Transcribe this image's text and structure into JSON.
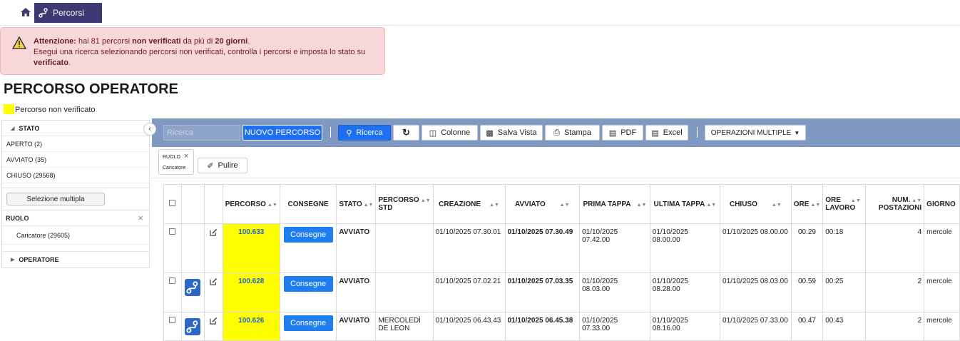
{
  "nav": {
    "tab_label": "Percorsi"
  },
  "alert": {
    "l1_prefix": "Attenzione:",
    "l1_a": " hai 81 percorsi ",
    "l1_b": "non verificati",
    "l1_c": " da più di ",
    "l1_d": "20 giorni",
    "l1_e": ".",
    "l2": "Esegui una ricerca selezionando percorsi non verificati, controlla i percorsi e imposta lo stato su",
    "l3_b": "verificato",
    "l3_e": "."
  },
  "page": {
    "title": "PERCORSO OPERATORE",
    "legend": "Percorso non verificato",
    "legend_color": "#ffff00"
  },
  "sidebar": {
    "stato_title": "STATO",
    "stato_items": [
      "APERTO (2)",
      "AVVIATO (35)",
      "CHIUSO (29568)"
    ],
    "multi_btn": "Selezione multipla",
    "ruolo_title": "RUOLO",
    "ruolo_items": [
      "Caricatore (29605)"
    ],
    "operatore_title": "OPERATORE"
  },
  "toolbar": {
    "search_placeholder": "Ricerca",
    "new_label": "NUOVO PERCORSO",
    "ricerca_label": "Ricerca",
    "colonne_label": "Colonne",
    "salva_label": "Salva Vista",
    "stampa_label": "Stampa",
    "pdf_label": "PDF",
    "excel_label": "Excel",
    "multi_label": "OPERAZIONI MULTIPLE"
  },
  "filters": {
    "chip_key": "RUOLO",
    "chip_value": "Caricatore",
    "clear_label": "Pulire"
  },
  "table": {
    "headers": {
      "percorso": "PERCORSO",
      "consegne": "CONSEGNE",
      "stato": "STATO",
      "percorso_std_1": "PERCORSO",
      "percorso_std_2": "STD",
      "creazione": "CREAZIONE",
      "avviato": "AVVIATO",
      "prima": "PRIMA TAPPA",
      "ultima": "ULTIMA TAPPA",
      "chiuso": "CHIUSO",
      "ore": "ORE",
      "ore_lavoro_1": "ORE",
      "ore_lavoro_2": "LAVORO",
      "num_1": "NUM.",
      "num_2": "POSTAZIONI",
      "giorno": "GIORNO"
    },
    "consegne_label": "Consegne",
    "rows": [
      {
        "percorso": "100.633",
        "stato": "AVVIATO",
        "std_1": "",
        "std_2": "",
        "creazione": "01/10/2025 07.30.01",
        "avviato": "01/10/2025 07.30.49",
        "prima": "01/10/2025 07.42.00",
        "ultima": "01/10/2025 08.00.00",
        "chiuso": "01/10/2025 08.00.00",
        "ore": "00.29",
        "ore_lavoro": "00:18",
        "num": "4",
        "giorno": "mercole"
      },
      {
        "percorso": "100.628",
        "stato": "AVVIATO",
        "std_1": "",
        "std_2": "",
        "creazione": "01/10/2025 07.02.21",
        "avviato": "01/10/2025 07.03.35",
        "prima": "01/10/2025 08.03.00",
        "ultima": "01/10/2025 08.28.00",
        "chiuso": "01/10/2025 08.03.00",
        "ore": "00.59",
        "ore_lavoro": "00:25",
        "num": "2",
        "giorno": "mercole"
      },
      {
        "percorso": "100.626",
        "stato": "AVVIATO",
        "std_1": "MERCOLEDÌ",
        "std_2": "DE LEON",
        "creazione": "01/10/2025 06.43.43",
        "avviato": "01/10/2025 06.45.38",
        "prima": "01/10/2025 07.33.00",
        "ultima": "01/10/2025 08.16.00",
        "chiuso": "01/10/2025 07.33.00",
        "ore": "00.47",
        "ore_lavoro": "00:43",
        "num": "2",
        "giorno": "mercole"
      }
    ]
  }
}
